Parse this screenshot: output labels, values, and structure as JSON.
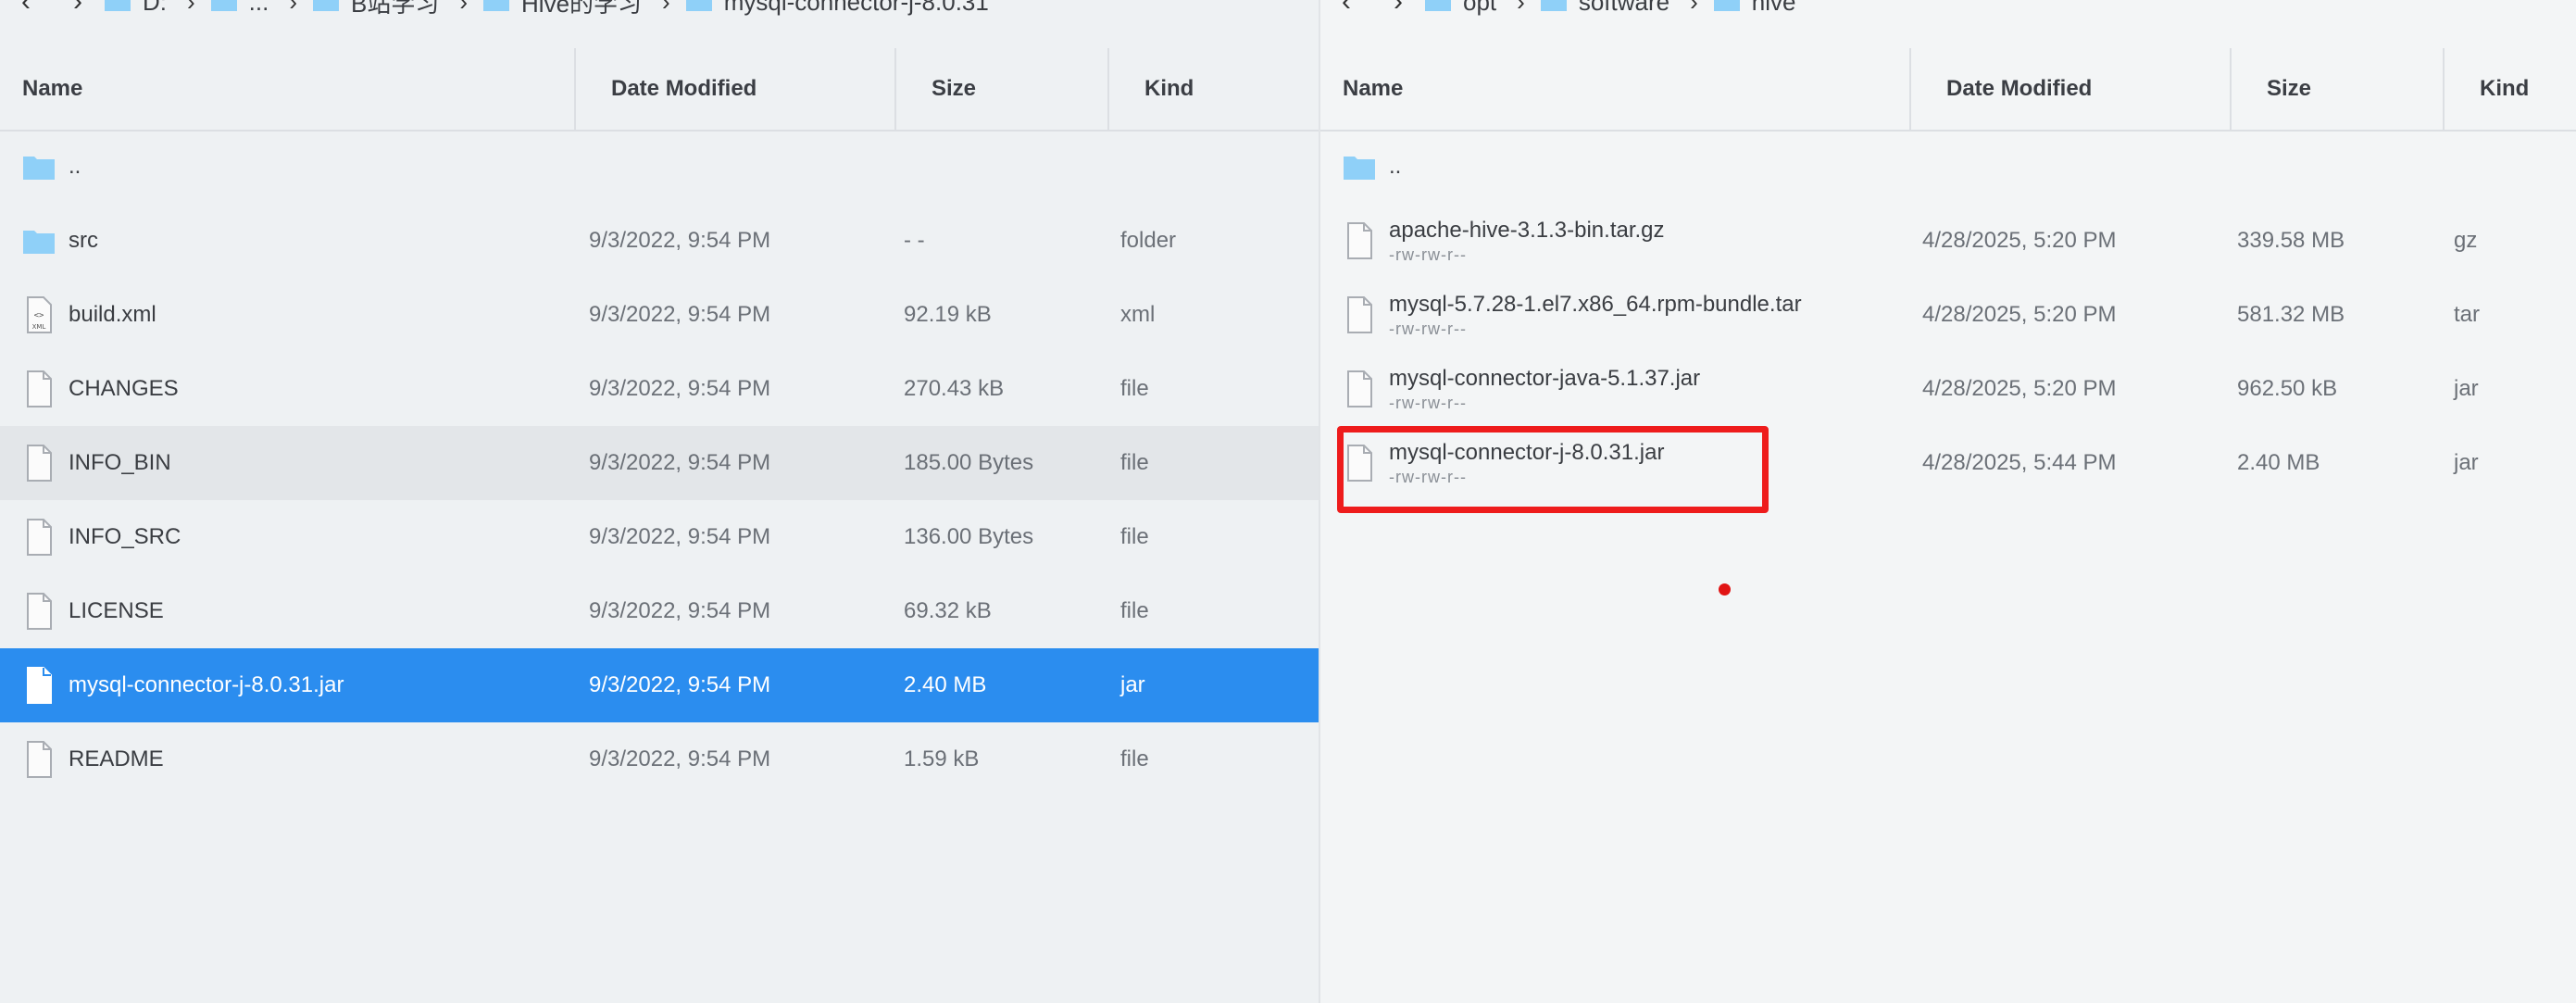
{
  "left": {
    "breadcrumb": [
      "D:",
      "...",
      "B站学习",
      "Hive的学习",
      "mysql-connector-j-8.0.31"
    ],
    "columns": {
      "name": "Name",
      "date": "Date Modified",
      "size": "Size",
      "kind": "Kind"
    },
    "rows": [
      {
        "name": "..",
        "date": "",
        "size": "",
        "kind": "",
        "icon": "folder-icon"
      },
      {
        "name": "src",
        "date": "9/3/2022, 9:54 PM",
        "size": "- -",
        "kind": "folder",
        "icon": "folder-icon"
      },
      {
        "name": "build.xml",
        "date": "9/3/2022, 9:54 PM",
        "size": "92.19 kB",
        "kind": "xml",
        "icon": "xml-file-icon"
      },
      {
        "name": "CHANGES",
        "date": "9/3/2022, 9:54 PM",
        "size": "270.43 kB",
        "kind": "file",
        "icon": "file-icon"
      },
      {
        "name": "INFO_BIN",
        "date": "9/3/2022, 9:54 PM",
        "size": "185.00 Bytes",
        "kind": "file",
        "icon": "file-icon"
      },
      {
        "name": "INFO_SRC",
        "date": "9/3/2022, 9:54 PM",
        "size": "136.00 Bytes",
        "kind": "file",
        "icon": "file-icon"
      },
      {
        "name": "LICENSE",
        "date": "9/3/2022, 9:54 PM",
        "size": "69.32 kB",
        "kind": "file",
        "icon": "file-icon"
      },
      {
        "name": "mysql-connector-j-8.0.31.jar",
        "date": "9/3/2022, 9:54 PM",
        "size": "2.40 MB",
        "kind": "jar",
        "icon": "file-icon"
      },
      {
        "name": "README",
        "date": "9/3/2022, 9:54 PM",
        "size": "1.59 kB",
        "kind": "file",
        "icon": "file-icon"
      }
    ]
  },
  "right": {
    "breadcrumb": [
      "opt",
      "software",
      "hive"
    ],
    "columns": {
      "name": "Name",
      "date": "Date Modified",
      "size": "Size",
      "kind": "Kind"
    },
    "rows": [
      {
        "name": "..",
        "perm": "",
        "date": "",
        "size": "",
        "kind": "",
        "icon": "folder-icon"
      },
      {
        "name": "apache-hive-3.1.3-bin.tar.gz",
        "perm": "-rw-rw-r--",
        "date": "4/28/2025, 5:20 PM",
        "size": "339.58 MB",
        "kind": "gz",
        "icon": "file-icon"
      },
      {
        "name": "mysql-5.7.28-1.el7.x86_64.rpm-bundle.tar",
        "perm": "-rw-rw-r--",
        "date": "4/28/2025, 5:20 PM",
        "size": "581.32 MB",
        "kind": "tar",
        "icon": "file-icon"
      },
      {
        "name": "mysql-connector-java-5.1.37.jar",
        "perm": "-rw-rw-r--",
        "date": "4/28/2025, 5:20 PM",
        "size": "962.50 kB",
        "kind": "jar",
        "icon": "file-icon"
      },
      {
        "name": "mysql-connector-j-8.0.31.jar",
        "perm": "-rw-rw-r--",
        "date": "4/28/2025, 5:44 PM",
        "size": "2.40 MB",
        "kind": "jar",
        "icon": "file-icon"
      }
    ]
  },
  "colors": {
    "selection": "#2b8def",
    "highlight": "#ee1c1c",
    "folder": "#8fd0f8"
  }
}
